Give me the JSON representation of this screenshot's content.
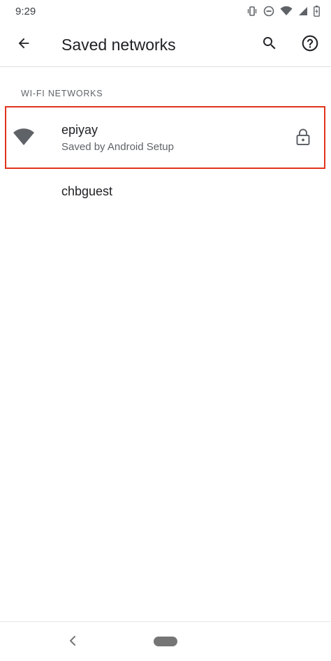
{
  "status_bar": {
    "time": "9:29",
    "icons": [
      "vibrate-icon",
      "do-not-disturb-icon",
      "wifi-signal-icon",
      "cell-signal-icon",
      "battery-charging-icon"
    ]
  },
  "app_bar": {
    "title": "Saved networks",
    "icons": [
      "back-arrow-icon",
      "search-icon",
      "help-icon"
    ]
  },
  "section": {
    "header": "WI-FI NETWORKS"
  },
  "networks": [
    {
      "name": "epiyay",
      "summary": "Saved by Android Setup",
      "icon": "wifi-icon",
      "secured_icon": "lock-icon"
    },
    {
      "name": "chbguest"
    }
  ],
  "colors": {
    "highlight": "#e0341c",
    "text_primary": "#202124",
    "text_secondary": "#5f6368",
    "icon": "#5f6368"
  }
}
